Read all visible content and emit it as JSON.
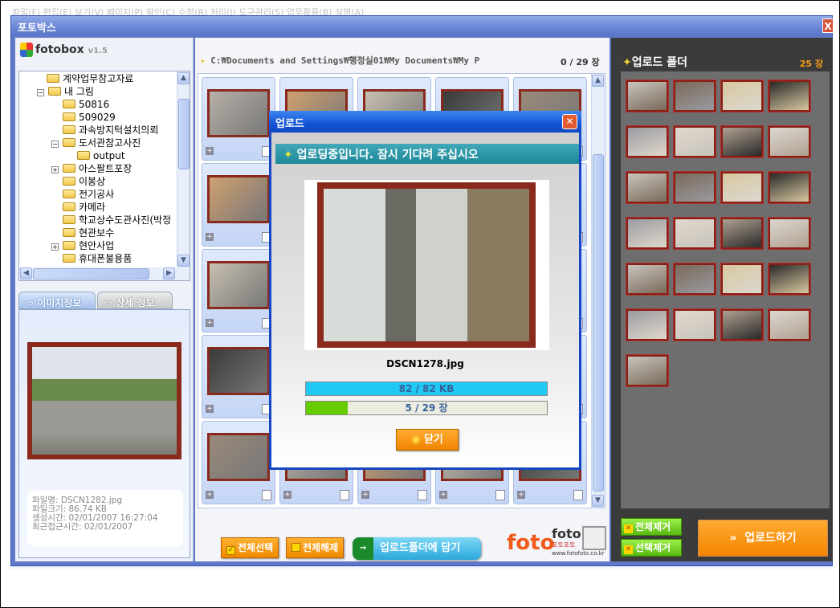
{
  "background": {
    "menu_text": "파일(F)  편집(E)  보기(V)  페이지(P)  확인(C)  수정(R)  처리(I)  도구관리(S)  업무활용(B)  설명(A)"
  },
  "window": {
    "title": "포토박스",
    "close": "X"
  },
  "left": {
    "logo": "fotobox",
    "version": "v1.5",
    "tree": [
      {
        "label": "계약업무참고자료",
        "level": 1,
        "toggle": ""
      },
      {
        "label": "내 그림",
        "level": 0,
        "toggle": "−"
      },
      {
        "label": "50816",
        "level": 2,
        "toggle": ""
      },
      {
        "label": "509029",
        "level": 2,
        "toggle": ""
      },
      {
        "label": "과속방지턱설치의뢰",
        "level": 2,
        "toggle": ""
      },
      {
        "label": "도서관참고사진",
        "level": 2,
        "toggle": "−"
      },
      {
        "label": "output",
        "level": 3,
        "toggle": ""
      },
      {
        "label": "아스팔트포장",
        "level": 2,
        "toggle": "+"
      },
      {
        "label": "이봉상",
        "level": 2,
        "toggle": ""
      },
      {
        "label": "전기공사",
        "level": 2,
        "toggle": ""
      },
      {
        "label": "카메라",
        "level": 2,
        "toggle": ""
      },
      {
        "label": "학교상수도관사진(박정",
        "level": 2,
        "toggle": ""
      },
      {
        "label": "현관보수",
        "level": 2,
        "toggle": ""
      },
      {
        "label": "현안사업",
        "level": 2,
        "toggle": "+"
      },
      {
        "label": "휴대폰불용품",
        "level": 2,
        "toggle": ""
      }
    ],
    "tabs": [
      {
        "label": "이미지정보",
        "active": true
      },
      {
        "label": "상세 정보",
        "active": false
      }
    ],
    "info": {
      "filename": "파일명: DSCN1282.jpg",
      "filesize": "파일크기: 86.74 KB",
      "created": "생성시간: 02/01/2007 16:27:04",
      "accessed": "최근접근시간: 02/01/2007"
    }
  },
  "center": {
    "path": "C:₩Documents and Settings₩행정실01₩My Documents₩My P",
    "count": "0 / 29 장",
    "select_all": "전체선택",
    "deselect_all": "전체해제",
    "add_to_upload": "업로드폴더에 담기",
    "brand": {
      "foto": "foto",
      "sub": "포토포토",
      "url": "www.fotofoto.co.kr"
    }
  },
  "right": {
    "title": "업로드 폴더",
    "count": "25 장",
    "remove_all": "전체제거",
    "remove_selected": "선택제거",
    "upload": "업로드하기",
    "thumb_count": 25
  },
  "dialog": {
    "title": "업로드",
    "banner": "업로딩중입니다. 잠시 기다려 주십시오",
    "filename": "DSCN1278.jpg",
    "file_progress": {
      "text": "82 / 82 KB",
      "fraction": 1.0
    },
    "total_progress": {
      "text": "5 / 29 장",
      "fraction": 0.172
    },
    "close_button": "닫기",
    "colors": {
      "file_bar": "#22c8f4",
      "total_bar": "#66cc00"
    }
  }
}
